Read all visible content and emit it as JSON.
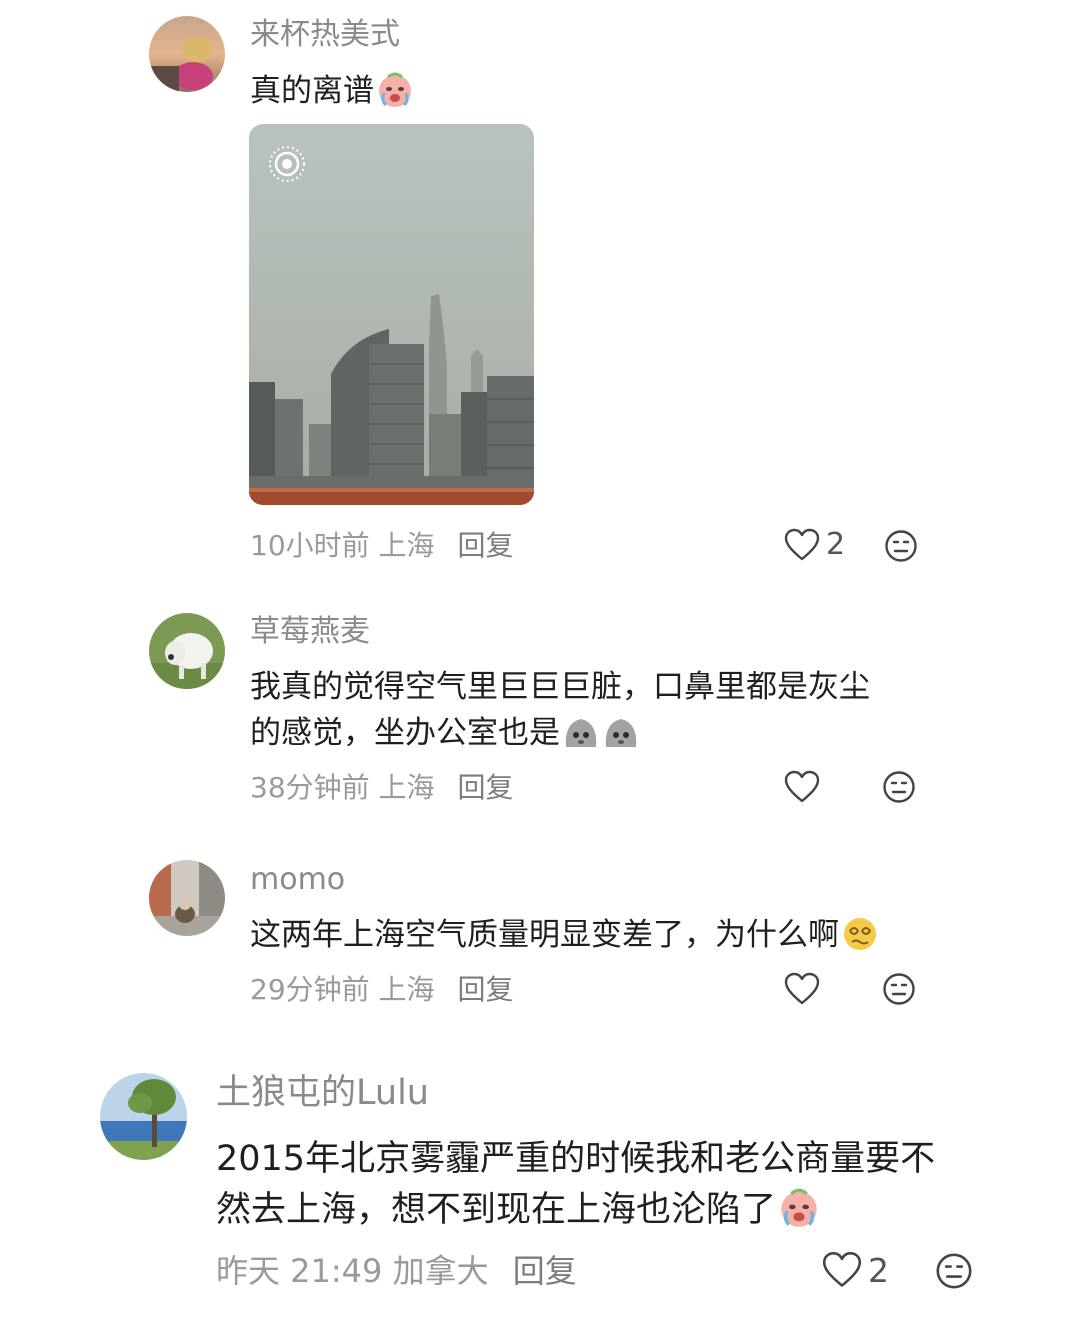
{
  "comments": [
    {
      "username": "来杯热美式",
      "text": "真的离谱",
      "emoji": "crying-face-emoji",
      "time": "10小时前",
      "location": "上海",
      "reply_label": "回复",
      "likes": "2"
    },
    {
      "username": "草莓燕麦",
      "text_line1": "我真的觉得空气里巨巨巨脏，口鼻里都是灰尘",
      "text_line2": "的感觉，坐办公室也是",
      "emoji": "gray-blob-emoji",
      "time": "38分钟前",
      "location": "上海",
      "reply_label": "回复"
    },
    {
      "username": "momo",
      "text": "这两年上海空气质量明显变差了，为什么啊",
      "emoji": "dizzy-face-emoji",
      "time": "29分钟前",
      "location": "上海",
      "reply_label": "回复"
    },
    {
      "username": "土狼屯的Lulu",
      "text_line1": "2015年北京雾霾严重的时候我和老公商量要不",
      "text_line2": "然去上海，想不到现在上海也沦陷了",
      "emoji": "crying-face-emoji",
      "time": "昨天 21:49",
      "location": "加拿大",
      "reply_label": "回复",
      "likes": "2"
    }
  ],
  "icons": {
    "like": "heart-outline-icon",
    "dislike": "neutral-face-icon",
    "live_photo": "live-photo-icon"
  },
  "colors": {
    "username": "#8a8a8a",
    "meta": "#9a9a9a",
    "text": "#1f1f1f"
  }
}
